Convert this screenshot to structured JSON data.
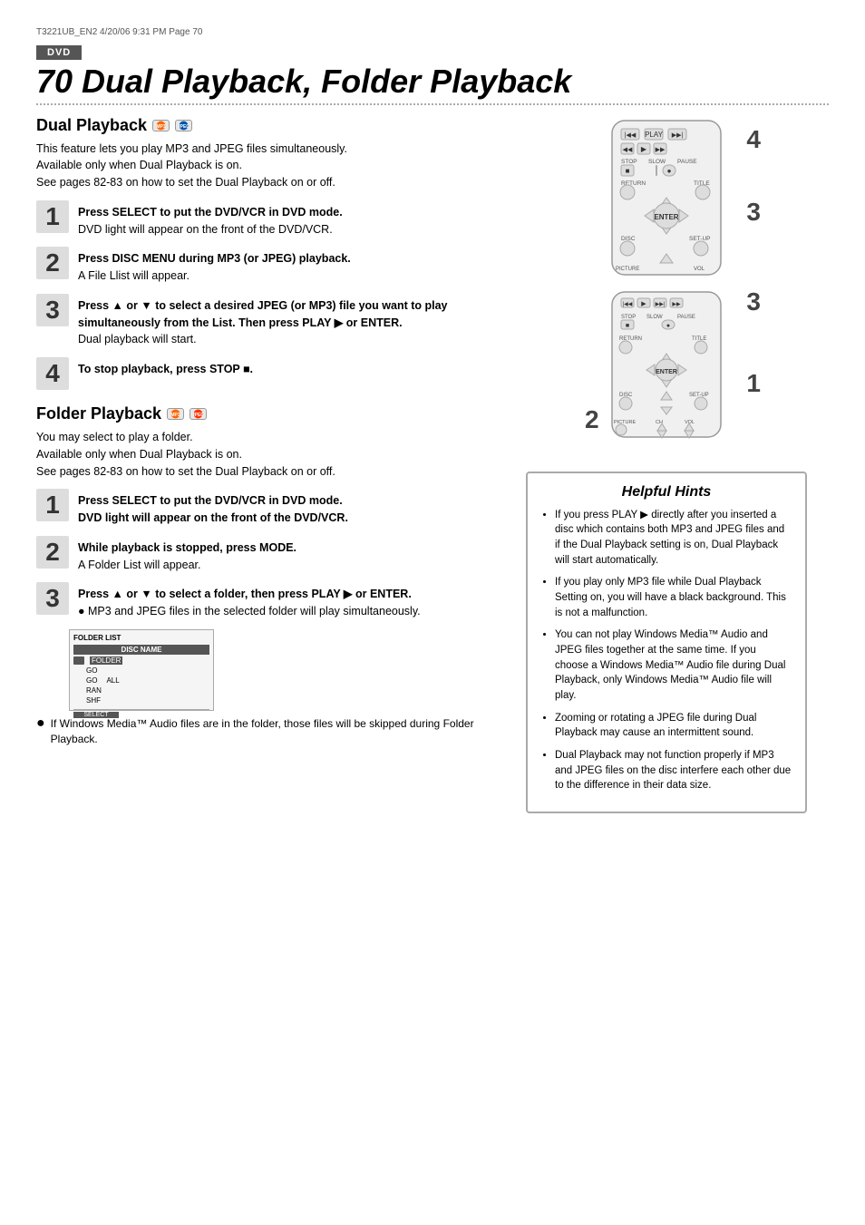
{
  "meta": {
    "line": "T3221UB_EN2  4/20/06  9:31 PM  Page 70"
  },
  "dvd_banner": "DVD",
  "page_title": "70  Dual Playback, Folder Playback",
  "dual_playback": {
    "title": "Dual Playback",
    "badges": [
      "MP3",
      "JPEG"
    ],
    "desc1": "This feature lets you play MP3 and JPEG files simultaneously.",
    "desc2": "Available only when Dual Playback is on.",
    "desc3": "See pages 82-83 on how to set the Dual Playback on or off.",
    "steps": [
      {
        "num": "1",
        "title": "Press SELECT to put the DVD/VCR in DVD mode.",
        "body": "DVD light will appear on the front of the DVD/VCR."
      },
      {
        "num": "2",
        "title": "Press DISC MENU during MP3 (or JPEG) playback.",
        "body": "A File Llist will appear."
      },
      {
        "num": "3",
        "title": "Press ▲ or ▼ to select a desired JPEG (or MP3) file you want to play simultaneously from the List. Then press PLAY ▶ or ENTER.",
        "body": "Dual playback will start."
      },
      {
        "num": "4",
        "title": "To stop playback, press STOP ■.",
        "body": ""
      }
    ],
    "remote_labels": [
      "4",
      "3",
      "2",
      "1"
    ]
  },
  "folder_playback": {
    "title": "Folder Playback",
    "badges": [
      "MP3",
      "JPEG"
    ],
    "desc1": "You may select to play a folder.",
    "desc2": "Available only when Dual Playback is on.",
    "desc3": "See pages 82-83 on how to set the Dual Playback on or off.",
    "steps": [
      {
        "num": "1",
        "title": "Press SELECT to put the DVD/VCR in DVD mode.",
        "body": "DVD light will appear on the front of the DVD/VCR."
      },
      {
        "num": "2",
        "title": "While playback is stopped, press MODE.",
        "body": "A Folder List will appear."
      },
      {
        "num": "3",
        "title": "Press ▲ or ▼ to select a folder, then press PLAY ▶ or ENTER.",
        "body": "● MP3 and JPEG files in the selected folder will play simultaneously."
      }
    ],
    "note": "● If Windows Media™ Audio files are in the folder, those files will be skipped during Folder Playback.",
    "remote_labels": [
      "3",
      "1",
      "2"
    ]
  },
  "hints": {
    "title": "Helpful Hints",
    "items": [
      "If you press PLAY ▶ directly after you inserted a disc which contains both MP3 and JPEG files and if the Dual Playback setting is on, Dual Playback will start automatically.",
      "If you play only MP3 file while Dual Playback Setting on, you will have a black background. This is not a malfunction.",
      "You can not play Windows Media™ Audio and JPEG files together at the same time.  If you choose a Windows Media™ Audio file during Dual Playback, only Windows Media™ Audio file will play.",
      "Zooming or rotating a JPEG file during Dual Playback may cause an intermittent sound.",
      "Dual Playback may not function properly if MP3 and JPEG files on the disc interfere each other due to the difference in their data size."
    ]
  }
}
